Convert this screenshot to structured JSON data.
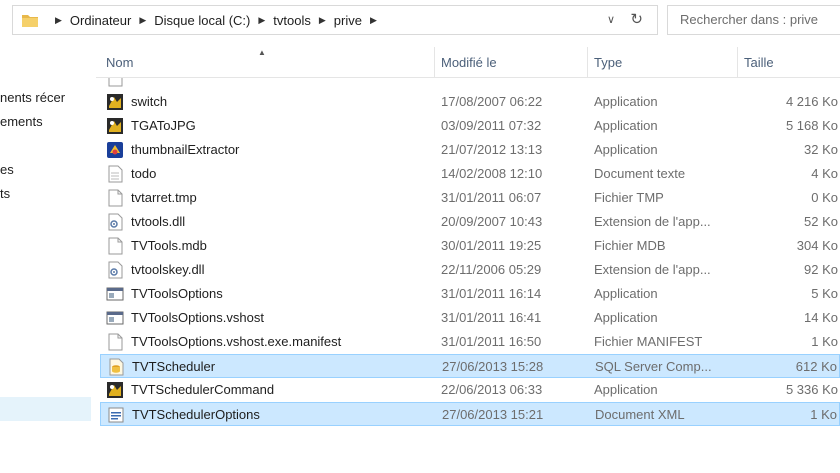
{
  "address_bar": {
    "crumbs": [
      "Ordinateur",
      "Disque local (C:)",
      "tvtools",
      "prive"
    ]
  },
  "search": {
    "placeholder": "Rechercher dans : prive"
  },
  "nav_pane": {
    "items": [
      "nents récer",
      "ements",
      "es",
      "ts"
    ]
  },
  "columns": {
    "name": "Nom",
    "date": "Modifié le",
    "type": "Type",
    "size": "Taille"
  },
  "files": [
    {
      "name": "switch",
      "date": "17/08/2007 06:22",
      "type": "Application",
      "size": "4 216 Ko",
      "icon": "app-colorful-icon",
      "selected": false
    },
    {
      "name": "TGAToJPG",
      "date": "03/09/2011 07:32",
      "type": "Application",
      "size": "5 168 Ko",
      "icon": "app-colorful-icon",
      "selected": false
    },
    {
      "name": "thumbnailExtractor",
      "date": "21/07/2012 13:13",
      "type": "Application",
      "size": "32 Ko",
      "icon": "app-blue-icon",
      "selected": false
    },
    {
      "name": "todo",
      "date": "14/02/2008 12:10",
      "type": "Document texte",
      "size": "4 Ko",
      "icon": "text-document-icon",
      "selected": false
    },
    {
      "name": "tvtarret.tmp",
      "date": "31/01/2011 06:07",
      "type": "Fichier TMP",
      "size": "0 Ko",
      "icon": "blank-file-icon",
      "selected": false
    },
    {
      "name": "tvtools.dll",
      "date": "20/09/2007 10:43",
      "type": "Extension de l'app...",
      "size": "52 Ko",
      "icon": "dll-icon",
      "selected": false
    },
    {
      "name": "TVTools.mdb",
      "date": "30/01/2011 19:25",
      "type": "Fichier MDB",
      "size": "304 Ko",
      "icon": "blank-file-icon",
      "selected": false
    },
    {
      "name": "tvtoolskey.dll",
      "date": "22/11/2006 05:29",
      "type": "Extension de l'app...",
      "size": "92 Ko",
      "icon": "dll-icon",
      "selected": false
    },
    {
      "name": "TVToolsOptions",
      "date": "31/01/2011 16:14",
      "type": "Application",
      "size": "5 Ko",
      "icon": "window-app-icon",
      "selected": false
    },
    {
      "name": "TVToolsOptions.vshost",
      "date": "31/01/2011 16:41",
      "type": "Application",
      "size": "14 Ko",
      "icon": "window-app-icon",
      "selected": false
    },
    {
      "name": "TVToolsOptions.vshost.exe.manifest",
      "date": "31/01/2011 16:50",
      "type": "Fichier MANIFEST",
      "size": "1 Ko",
      "icon": "blank-file-icon",
      "selected": false
    },
    {
      "name": "TVTScheduler",
      "date": "27/06/2013 15:28",
      "type": "SQL Server Comp...",
      "size": "612 Ko",
      "icon": "database-file-icon",
      "selected": true
    },
    {
      "name": "TVTSchedulerCommand",
      "date": "22/06/2013 06:33",
      "type": "Application",
      "size": "5 336 Ko",
      "icon": "app-colorful-icon",
      "selected": false
    },
    {
      "name": "TVTSchedulerOptions",
      "date": "27/06/2013 15:21",
      "type": "Document XML",
      "size": "1 Ko",
      "icon": "xml-document-icon",
      "selected": true
    }
  ]
}
